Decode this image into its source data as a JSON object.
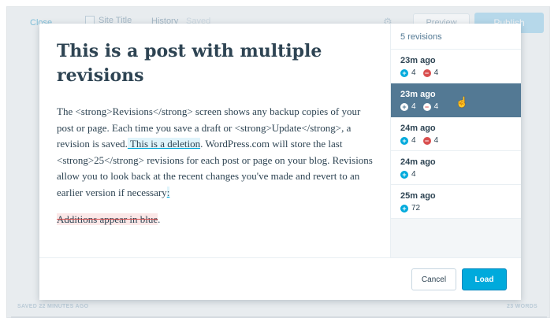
{
  "background": {
    "close_label": "Close",
    "site_title": "Site Title",
    "history_label": "History",
    "saved_label": "Saved",
    "preview_label": "Preview",
    "publish_label": "Publish",
    "footer_left": "SAVED 22 MINUTES AGO",
    "footer_right": "23 WORDS",
    "gear_icon": "gear-icon"
  },
  "post": {
    "title": "This is a post with multiple revisions",
    "para1_a": "The <strong>Revisions</strong> screen shows any backup copies of your post or page. Each time you save a draft or <strong>Update</strong>, a revision is saved.",
    "para1_added": " This is a deletion",
    "para1_b": ". WordPress.com will store the last <strong>25</strong> revisions for each post or page on your blog. Revisions allow you to look back at the recent changes you've made and revert to an earlier version if necessary",
    "para1_end": ":",
    "para2_deleted": "Additions appear in blue",
    "para2_end": "."
  },
  "sidebar": {
    "header": "5 revisions",
    "revisions": [
      {
        "time": "23m ago",
        "added": "4",
        "removed": "4"
      },
      {
        "time": "23m ago",
        "added": "4",
        "removed": "4"
      },
      {
        "time": "24m ago",
        "added": "4",
        "removed": "4"
      },
      {
        "time": "24m ago",
        "added": "4"
      },
      {
        "time": "25m ago",
        "added": "72"
      }
    ]
  },
  "footer": {
    "cancel_label": "Cancel",
    "load_label": "Load"
  },
  "colors": {
    "accent": "#00aadc",
    "selected": "#537994",
    "deletion": "#d94f4f"
  }
}
